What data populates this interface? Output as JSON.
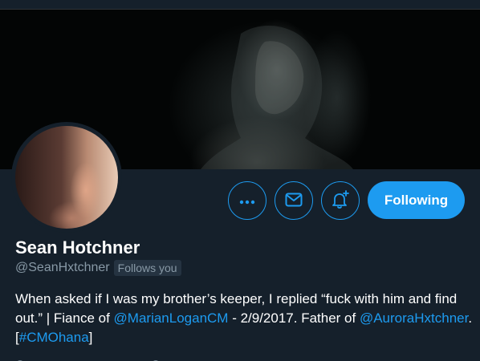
{
  "colors": {
    "background": "#15202b",
    "accent": "#1d9bf0",
    "muted": "#8899a6"
  },
  "profile": {
    "name": "Sean Hotchner",
    "handle": "@SeanHxtchner",
    "follows_you": "Follows you",
    "bio": {
      "p1": "When asked if I was my brother’s keeper, I replied “fuck with him and find out.” | Fiance of ",
      "mention1": "@MarianLoganCM",
      "p2": " - 2/9/2017. Father of ",
      "mention2": "@AuroraHxtchner",
      "p3": ". [",
      "hashtag": "#CMOhana",
      "p4": "]"
    }
  },
  "actions": {
    "more_icon": "more-icon",
    "message_icon": "mail-icon",
    "notify_icon": "bell-plus-icon",
    "following_label": "Following"
  }
}
